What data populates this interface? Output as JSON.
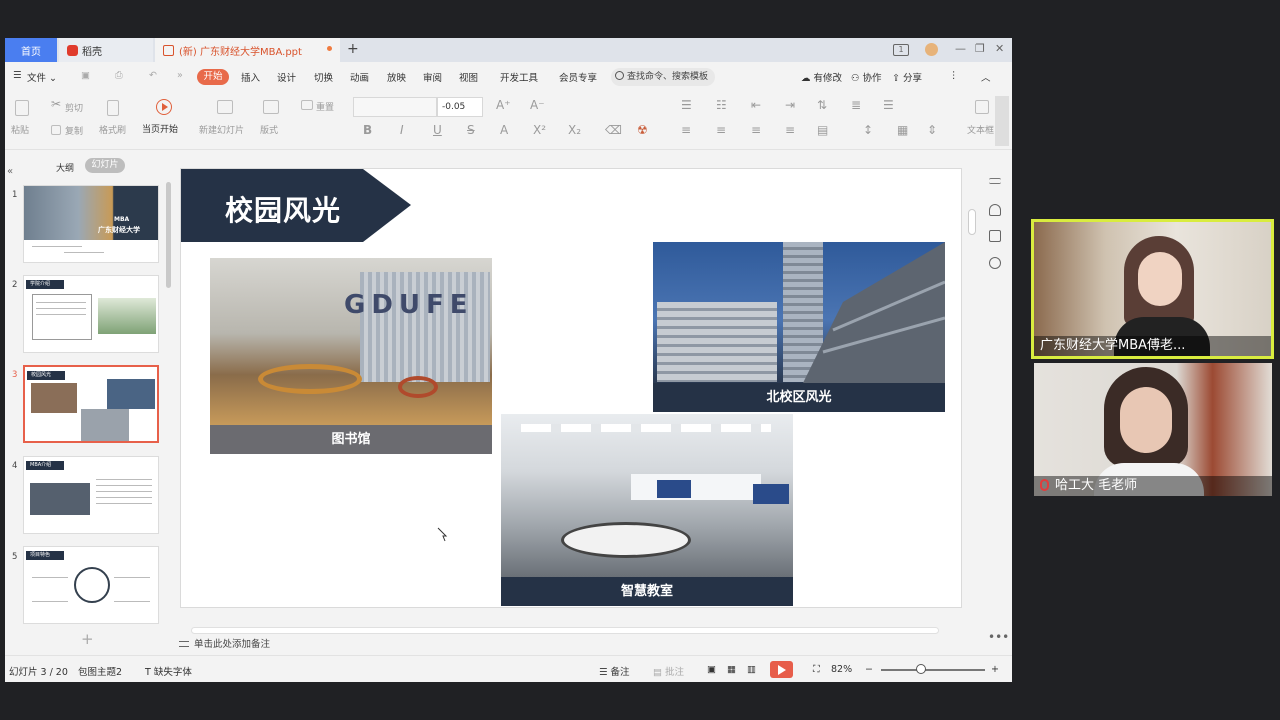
{
  "tabs": {
    "home": "首页",
    "daoke": "稻壳",
    "doc": "(新) 广东财经大学MBA.ppt"
  },
  "menu": {
    "file": "文件",
    "items": [
      "开始",
      "插入",
      "设计",
      "切换",
      "动画",
      "放映",
      "审阅",
      "视图",
      "开发工具",
      "会员专享"
    ],
    "search": "查找命令、搜索模板",
    "changes": "有修改",
    "collab": "协作",
    "share": "分享"
  },
  "ribbon": {
    "paste": "粘贴",
    "cut": "剪切",
    "copy": "复制",
    "format_painter": "格式刷",
    "play_from_current": "当页开始",
    "new_slide": "新建幻灯片",
    "layout": "版式",
    "reset": "重置",
    "font_size": "-0.05",
    "textbox": "文本框"
  },
  "left_panel": {
    "outline_tab": "大纲",
    "slides_tab": "幻灯片",
    "thumbs": [
      {
        "num": "1",
        "title": "MBA",
        "subtitle": "广东财经大学"
      },
      {
        "num": "2",
        "header": "学院介绍"
      },
      {
        "num": "3",
        "header": "校园风光"
      },
      {
        "num": "4",
        "header": "MBA介绍"
      },
      {
        "num": "5",
        "header": "项目特色"
      }
    ]
  },
  "slide": {
    "title": "校园风光",
    "photos": {
      "library": "图书馆",
      "north_campus": "北校区风光",
      "smart_classroom": "智慧教室"
    }
  },
  "notes_placeholder": "单击此处添加备注",
  "status": {
    "slide_counter": "幻灯片 3 / 20",
    "theme": "包图主题2",
    "missing_font": "缺失字体",
    "notes": "备注",
    "comments": "批注",
    "zoom": "82%"
  },
  "video": {
    "participant1": "广东财经大学MBA傅老...",
    "participant2": "哈工大 毛老师"
  },
  "colors": {
    "accent": "#e86a4a",
    "slide_navy": "#253246",
    "caption_gray": "#6b6b70",
    "video_highlight": "#d9ec3f"
  }
}
